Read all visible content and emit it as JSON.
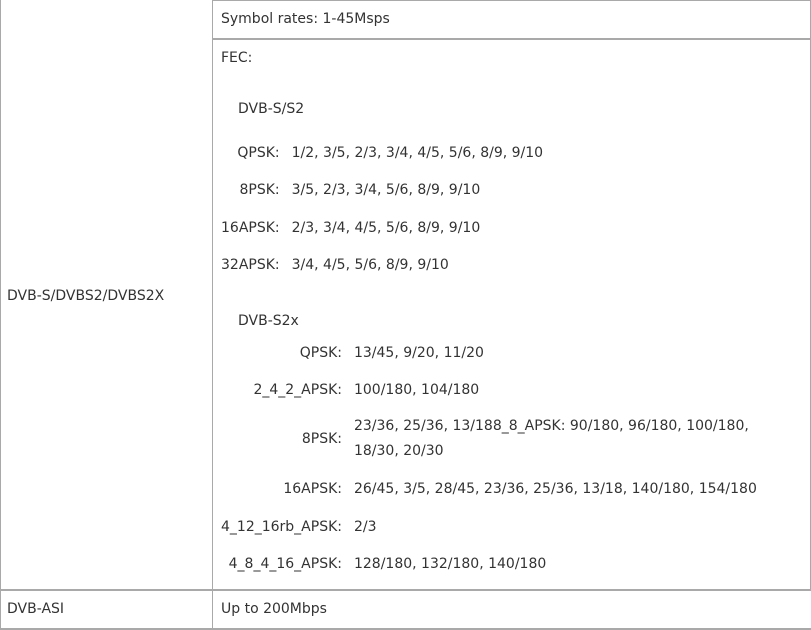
{
  "left_col": {
    "dvb_s_label": "DVB-S/DVBS2/DVBS2X",
    "dvb_asi_label": "DVB-ASI"
  },
  "right_col": {
    "symbol_rates": "Symbol rates: 1-45Msps",
    "fec_title": "FEC:",
    "dvbs_s2_heading": "DVB-S/S2",
    "dvbs_s2_rows": [
      {
        "label": "QPSK:",
        "value": "1/2, 3/5, 2/3, 3/4, 4/5, 5/6, 8/9, 9/10"
      },
      {
        "label": "8PSK:",
        "value": "3/5, 2/3, 3/4, 5/6, 8/9, 9/10"
      },
      {
        "label": "16APSK:",
        "value": "2/3, 3/4, 4/5, 5/6, 8/9, 9/10"
      },
      {
        "label": "32APSK:",
        "value": "3/4, 4/5, 5/6, 8/9, 9/10"
      }
    ],
    "dvbs2x_heading": "DVB-S2x",
    "dvbs2x_rows": [
      {
        "label": "QPSK:",
        "value": "13/45, 9/20, 11/20"
      },
      {
        "label": "2_4_2_APSK:",
        "value": "100/180, 104/180"
      },
      {
        "label": "8PSK:",
        "value": "23/36, 25/36, 13/188_8_APSK: 90/180, 96/180, 100/180, 18/30, 20/30"
      },
      {
        "label": "16APSK:",
        "value": "26/45, 3/5, 28/45, 23/36, 25/36, 13/18, 140/180, 154/180"
      },
      {
        "label": "4_12_16rb_APSK:",
        "value": "2/3"
      },
      {
        "label": "4_8_4_16_APSK:",
        "value": "128/180, 132/180, 140/180"
      }
    ],
    "dvb_asi_value": "Up to 200Mbps"
  }
}
